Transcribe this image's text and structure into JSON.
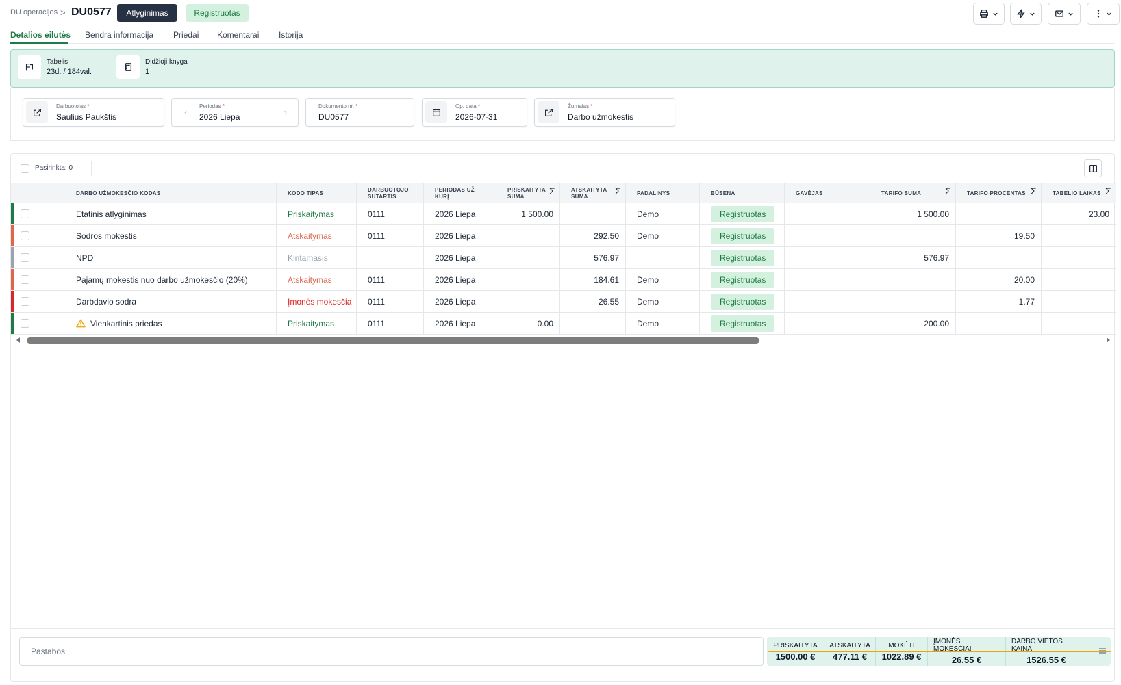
{
  "breadcrumb": {
    "parent": "DU operacijos",
    "separator": ">"
  },
  "document": {
    "title": "DU0577",
    "type_badge": "Atlyginimas",
    "status_badge": "Registruotas"
  },
  "toolbar": {
    "icons": [
      "printer-icon",
      "bolt-icon",
      "mail-icon",
      "more-vertical-icon"
    ]
  },
  "tabs": [
    {
      "label": "Detalios eilutės",
      "active": true
    },
    {
      "label": "Bendra informacija",
      "active": false
    },
    {
      "label": "Priedai",
      "active": false
    },
    {
      "label": "Komentarai",
      "active": false
    },
    {
      "label": "Istorija",
      "active": false
    }
  ],
  "info": [
    {
      "label": "Tabelis",
      "value": "23d. / 184val."
    },
    {
      "label": "Didžioji knyga",
      "value": "1"
    }
  ],
  "fields": {
    "employee": {
      "label": "Darbuotojas",
      "value": "Saulius Paukštis"
    },
    "period": {
      "label": "Periodas",
      "value": "2026 Liepa"
    },
    "doc_no": {
      "label": "Dokumento nr.",
      "value": "DU0577"
    },
    "op_date": {
      "label": "Op. data",
      "value": "2026-07-31"
    },
    "journal": {
      "label": "Žurnalas",
      "value": "Darbo užmokestis"
    },
    "required_mark": "*"
  },
  "table": {
    "selected_text": "Pasirinkta: 0",
    "columns": [
      "DARBO UŽMOKESČIO KODAS",
      "KODO TIPAS",
      "DARBUOTOJO SUTARTIS",
      "PERIODAS UŽ KURĮ",
      "PRISKAITYTA SUMA",
      "ATSKAITYTA SUMA",
      "PADALINYS",
      "BŪSENA",
      "GAVĖJAS",
      "TARIFO SUMA",
      "TARIFO PROCENTAS",
      "TABELIO LAIKAS"
    ],
    "sigma": "Σ",
    "rows": [
      {
        "code": "Etatinis atlyginimas",
        "type": "Priskaitymas",
        "type_color": "#1f7a46",
        "stripe": "#1f7a46",
        "contract": "0111",
        "period": "2026 Liepa",
        "accrued": "1 500.00",
        "deducted": "",
        "dept": "Demo",
        "status": "Registruotas",
        "recipient": "",
        "rate_sum": "1 500.00",
        "rate_pct": "",
        "time": "23.00",
        "warning": false
      },
      {
        "code": "Sodros mokestis",
        "type": "Atskaitymas",
        "type_color": "#e0654a",
        "stripe": "#e0654a",
        "contract": "0111",
        "period": "2026 Liepa",
        "accrued": "",
        "deducted": "292.50",
        "dept": "Demo",
        "status": "Registruotas",
        "recipient": "",
        "rate_sum": "",
        "rate_pct": "19.50",
        "time": "",
        "warning": false
      },
      {
        "code": "NPD",
        "type": "Kintamasis",
        "type_color": "#9ca3af",
        "stripe": "#9ca3af",
        "contract": "",
        "period": "2026 Liepa",
        "accrued": "",
        "deducted": "576.97",
        "dept": "",
        "status": "Registruotas",
        "recipient": "",
        "rate_sum": "576.97",
        "rate_pct": "",
        "time": "",
        "warning": false
      },
      {
        "code": "Pajamų mokestis nuo darbo užmokesčio (20%)",
        "type": "Atskaitymas",
        "type_color": "#e0654a",
        "stripe": "#e0654a",
        "contract": "0111",
        "period": "2026 Liepa",
        "accrued": "",
        "deducted": "184.61",
        "dept": "Demo",
        "status": "Registruotas",
        "recipient": "",
        "rate_sum": "",
        "rate_pct": "20.00",
        "time": "",
        "warning": false
      },
      {
        "code": "Darbdavio sodra",
        "type": "Įmonės mokesčia",
        "type_color": "#dc2626",
        "stripe": "#dc2626",
        "contract": "0111",
        "period": "2026 Liepa",
        "accrued": "",
        "deducted": "26.55",
        "dept": "Demo",
        "status": "Registruotas",
        "recipient": "",
        "rate_sum": "",
        "rate_pct": "1.77",
        "time": "",
        "warning": false
      },
      {
        "code": "Vienkartinis priedas",
        "type": "Priskaitymas",
        "type_color": "#1f7a46",
        "stripe": "#1f7a46",
        "contract": "0111",
        "period": "2026 Liepa",
        "accrued": "0.00",
        "deducted": "",
        "dept": "Demo",
        "status": "Registruotas",
        "recipient": "",
        "rate_sum": "200.00",
        "rate_pct": "",
        "time": "",
        "warning": true
      }
    ]
  },
  "notes_placeholder": "Pastabos",
  "totals": [
    {
      "label": "PRISKAITYTA",
      "value": "1500.00 €"
    },
    {
      "label": "ATSKAITYTA",
      "value": "477.11 €"
    },
    {
      "label": "MOKĖTI",
      "value": "1022.89 €"
    },
    {
      "label": "ĮMONĖS MOKESČIAI",
      "value": "26.55 €"
    },
    {
      "label": "DARBO VIETOS KAINA",
      "value": "1526.55 €"
    }
  ],
  "colors": {
    "accent": "#1f7a46",
    "band": "#dff2ec",
    "dark_badge": "#263143",
    "warning": "#f0a500"
  }
}
